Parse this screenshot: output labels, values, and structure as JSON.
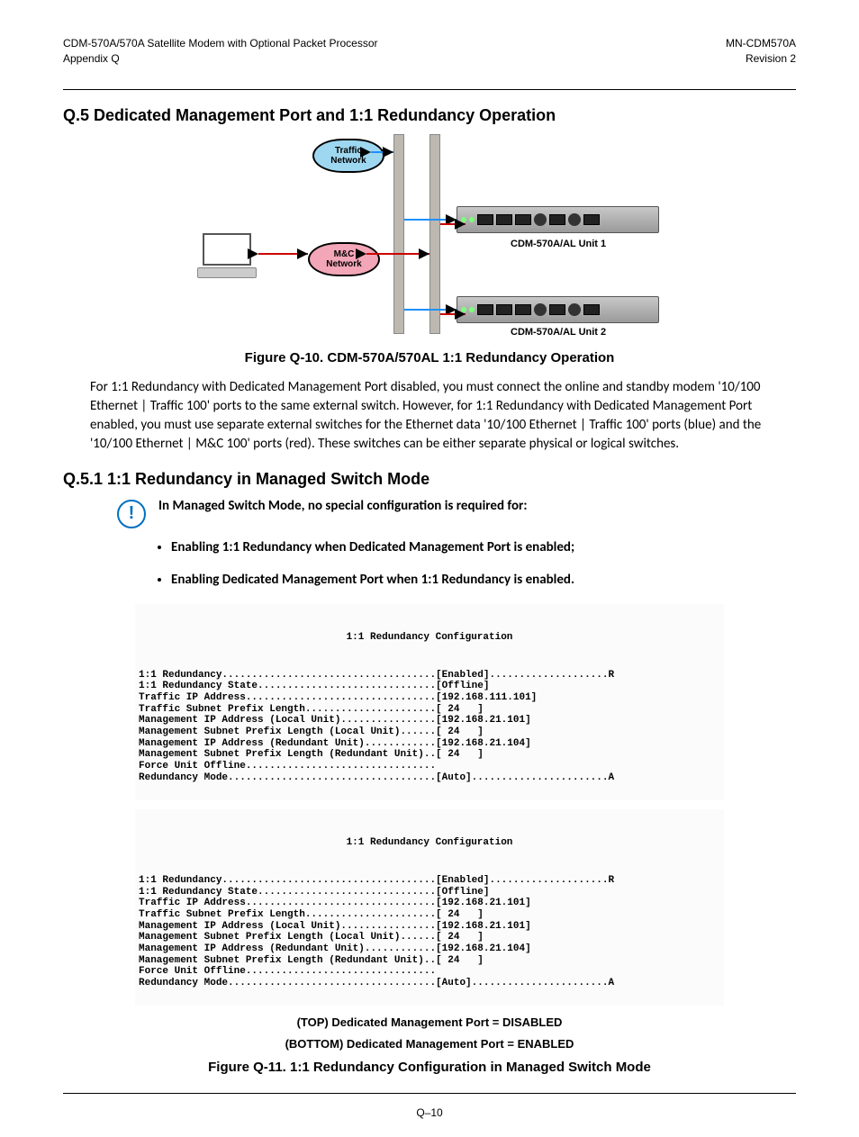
{
  "header": {
    "left_line1": "CDM-570A/570A Satellite Modem with Optional Packet Processor",
    "left_line2": "Appendix Q",
    "right_line1": "MN-CDM570A",
    "right_line2": "Revision 2"
  },
  "section_q5": {
    "heading": "Q.5   Dedicated Management Port and 1:1 Redundancy Operation",
    "diagram": {
      "traffic_label": "Traffic Network",
      "mc_label": "M&C Network",
      "unit1_label": "CDM-570A/AL Unit 1",
      "unit2_label": "CDM-570A/AL Unit 2"
    },
    "fig10_caption": "Figure Q-10. CDM-570A/570AL 1:1 Redundancy Operation",
    "para": "For 1:1 Redundancy with Dedicated Management Port disabled, you must connect the online and standby modem '10/100 Ethernet | Traffic 100' ports to the same external switch. However, for 1:1 Redundancy with Dedicated Management Port enabled, you must use separate external switches for the Ethernet data '10/100 Ethernet | Traffic 100' ports (blue) and the  '10/100 Ethernet | M&C 100' ports (red). These switches can be either separate physical or logical switches."
  },
  "section_q51": {
    "heading": "Q.5.1     1:1 Redundancy in Managed Switch Mode",
    "note": "In Managed Switch Mode, no special configuration is required for:",
    "bullet1": "Enabling 1:1 Redundancy when Dedicated Management Port is enabled;",
    "bullet2": "Enabling Dedicated Management Port when 1:1 Redundancy is enabled.",
    "term_title": "1:1 Redundancy Configuration",
    "term_top": "1:1 Redundancy....................................[Enabled]....................R\n1:1 Redundancy State..............................[Offline]\nTraffic IP Address................................[192.168.111.101]\nTraffic Subnet Prefix Length......................[ 24   ]\nManagement IP Address (Local Unit)................[192.168.21.101]\nManagement Subnet Prefix Length (Local Unit)......[ 24   ]\nManagement IP Address (Redundant Unit)............[192.168.21.104]\nManagement Subnet Prefix Length (Redundant Unit)..[ 24   ]\nForce Unit Offline................................\nRedundancy Mode...................................[Auto].......................A",
    "term_bottom": "1:1 Redundancy....................................[Enabled]....................R\n1:1 Redundancy State..............................[Offline]\nTraffic IP Address................................[192.168.21.101]\nTraffic Subnet Prefix Length......................[ 24   ]\nManagement IP Address (Local Unit)................[192.168.21.101]\nManagement Subnet Prefix Length (Local Unit)......[ 24   ]\nManagement IP Address (Redundant Unit)............[192.168.21.104]\nManagement Subnet Prefix Length (Redundant Unit)..[ 24   ]\nForce Unit Offline................................\nRedundancy Mode...................................[Auto].......................A",
    "caption_top": "(TOP) Dedicated Management Port = DISABLED",
    "caption_bottom": "(BOTTOM) Dedicated Management Port = ENABLED",
    "fig11_caption": "Figure Q-11. 1:1 Redundancy Configuration in Managed Switch Mode"
  },
  "footer": {
    "page": "Q–10"
  }
}
